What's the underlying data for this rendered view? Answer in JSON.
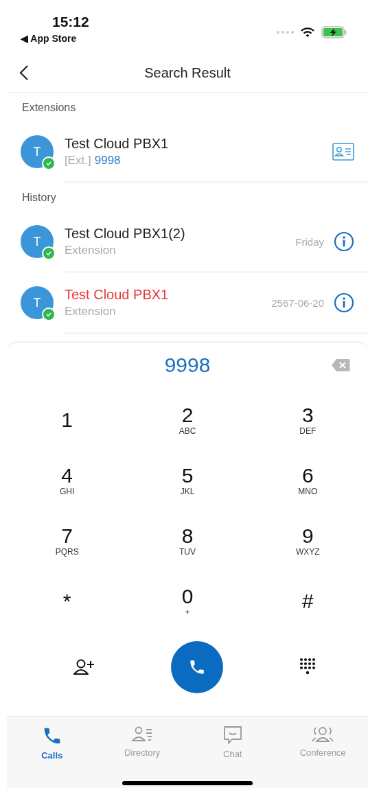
{
  "status_bar": {
    "time": "15:12",
    "back_app": "◀ App Store"
  },
  "nav": {
    "title": "Search Result"
  },
  "extensions": {
    "header": "Extensions",
    "items": [
      {
        "initial": "T",
        "name": "Test Cloud PBX1",
        "prefix": "[Ext.]",
        "number": "9998"
      }
    ]
  },
  "history": {
    "header": "History",
    "items": [
      {
        "initial": "T",
        "name": "Test Cloud PBX1(2)",
        "type": "Extension",
        "when": "Friday",
        "missed": false
      },
      {
        "initial": "T",
        "name": "Test Cloud PBX1",
        "type": "Extension",
        "when": "2567-06-20",
        "missed": true
      }
    ]
  },
  "dialpad": {
    "number": "9998",
    "keys": [
      {
        "digit": "1"
      },
      {
        "digit": "2",
        "letters": "ABC"
      },
      {
        "digit": "3",
        "letters": "DEF"
      },
      {
        "digit": "4",
        "letters": "GHI"
      },
      {
        "digit": "5",
        "letters": "JKL"
      },
      {
        "digit": "6",
        "letters": "MNO"
      },
      {
        "digit": "7",
        "letters": "PQRS"
      },
      {
        "digit": "8",
        "letters": "TUV"
      },
      {
        "digit": "9",
        "letters": "WXYZ"
      },
      {
        "digit": "*"
      },
      {
        "digit": "0",
        "letters": "+"
      },
      {
        "digit": "#"
      }
    ]
  },
  "tabs": [
    {
      "label": "Calls",
      "kind": "calls",
      "selected": true
    },
    {
      "label": "Directory",
      "kind": "directory",
      "selected": false
    },
    {
      "label": "Chat",
      "kind": "chat",
      "selected": false
    },
    {
      "label": "Conference",
      "kind": "conference",
      "selected": false
    }
  ]
}
